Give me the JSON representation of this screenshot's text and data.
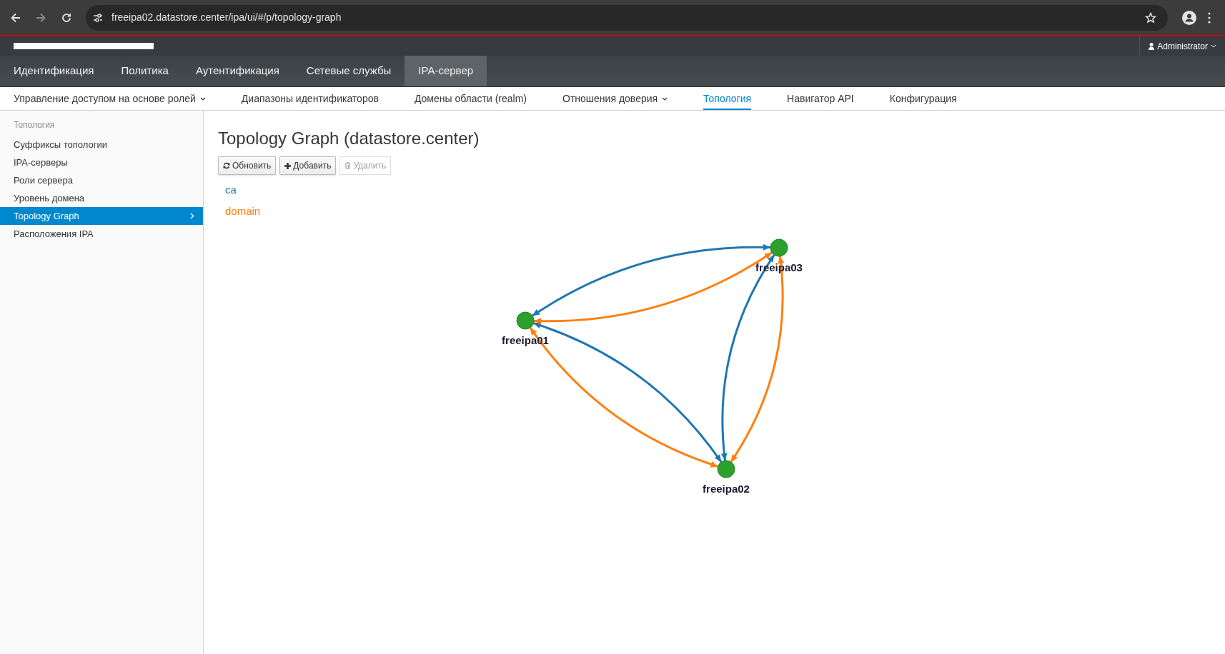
{
  "browser": {
    "url": "freeipa02.datastore.center/ipa/ui/#/p/topology-graph"
  },
  "header": {
    "user": "Administrator"
  },
  "nav_tabs": [
    {
      "label": "Идентификация",
      "selected": false
    },
    {
      "label": "Политика",
      "selected": false
    },
    {
      "label": "Аутентификация",
      "selected": false
    },
    {
      "label": "Сетевые службы",
      "selected": false
    },
    {
      "label": "IPA-сервер",
      "selected": true
    }
  ],
  "sub_tabs": [
    {
      "label": "Управление доступом на основе ролей",
      "dropdown": true,
      "selected": false
    },
    {
      "label": "Диапазоны идентификаторов",
      "dropdown": false,
      "selected": false
    },
    {
      "label": "Домены области (realm)",
      "dropdown": false,
      "selected": false
    },
    {
      "label": "Отношения доверия",
      "dropdown": true,
      "selected": false
    },
    {
      "label": "Топология",
      "dropdown": false,
      "selected": true
    },
    {
      "label": "Навигатор API",
      "dropdown": false,
      "selected": false
    },
    {
      "label": "Конфигурация",
      "dropdown": false,
      "selected": false
    }
  ],
  "sidebar": {
    "heading": "Топология",
    "items": [
      {
        "label": "Суффиксы топологии",
        "selected": false
      },
      {
        "label": "IPA-серверы",
        "selected": false
      },
      {
        "label": "Роли сервера",
        "selected": false
      },
      {
        "label": "Уровень домена",
        "selected": false
      },
      {
        "label": "Topology Graph",
        "selected": true
      },
      {
        "label": "Расположения IPA",
        "selected": false
      }
    ]
  },
  "page": {
    "title": "Topology Graph (datastore.center)",
    "buttons": [
      {
        "label": "Обновить",
        "kind": "refresh",
        "disabled": false
      },
      {
        "label": "Добавить",
        "kind": "add",
        "disabled": false
      },
      {
        "label": "Удалить",
        "kind": "delete",
        "disabled": true
      }
    ]
  },
  "suffixes": [
    {
      "name": "ca",
      "color": "#1f77b4"
    },
    {
      "name": "domain",
      "color": "#ff7f0e"
    }
  ],
  "graph": {
    "nodes": [
      {
        "name": "freeipa01"
      },
      {
        "name": "freeipa02"
      },
      {
        "name": "freeipa03"
      }
    ]
  }
}
